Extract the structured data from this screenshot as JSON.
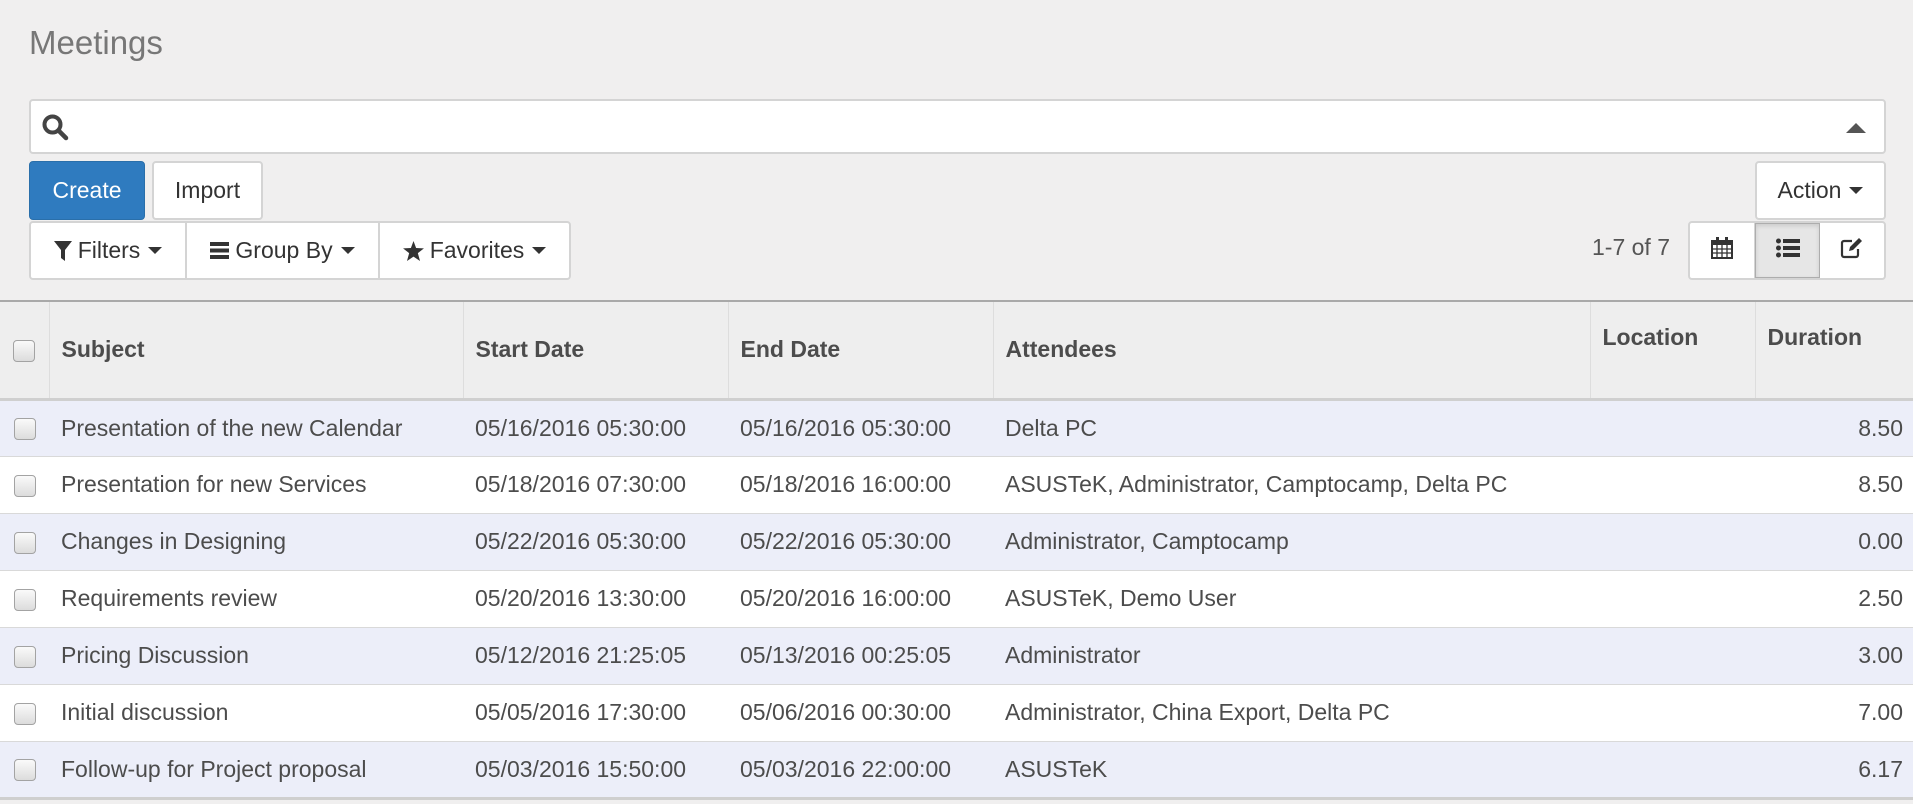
{
  "page": {
    "title": "Meetings"
  },
  "search": {
    "placeholder": "",
    "value": "",
    "icon": "search-icon",
    "toggle_icon": "caret-up-icon"
  },
  "toolbar": {
    "create_label": "Create",
    "import_label": "Import",
    "action_label": "Action"
  },
  "filters": {
    "filters_label": "Filters",
    "groupby_label": "Group By",
    "favorites_label": "Favorites"
  },
  "pager": {
    "text": "1-7 of 7"
  },
  "views": [
    {
      "name": "calendar",
      "icon": "calendar-icon",
      "active": false
    },
    {
      "name": "list",
      "icon": "list-icon",
      "active": true
    },
    {
      "name": "form",
      "icon": "edit-icon",
      "active": false
    }
  ],
  "table": {
    "columns": [
      "Subject",
      "Start Date",
      "End Date",
      "Attendees",
      "Location",
      "Duration"
    ],
    "rows": [
      {
        "subject": "Presentation of the new Calendar",
        "start": "05/16/2016 05:30:00",
        "end": "05/16/2016 05:30:00",
        "attendees": "Delta PC",
        "location": "",
        "duration": "8.50"
      },
      {
        "subject": "Presentation for new Services",
        "start": "05/18/2016 07:30:00",
        "end": "05/18/2016 16:00:00",
        "attendees": "ASUSTeK, Administrator, Camptocamp, Delta PC",
        "location": "",
        "duration": "8.50"
      },
      {
        "subject": "Changes in Designing",
        "start": "05/22/2016 05:30:00",
        "end": "05/22/2016 05:30:00",
        "attendees": "Administrator, Camptocamp",
        "location": "",
        "duration": "0.00"
      },
      {
        "subject": "Requirements review",
        "start": "05/20/2016 13:30:00",
        "end": "05/20/2016 16:00:00",
        "attendees": "ASUSTeK, Demo User",
        "location": "",
        "duration": "2.50"
      },
      {
        "subject": "Pricing Discussion",
        "start": "05/12/2016 21:25:05",
        "end": "05/13/2016 00:25:05",
        "attendees": "Administrator",
        "location": "",
        "duration": "3.00"
      },
      {
        "subject": "Initial discussion",
        "start": "05/05/2016 17:30:00",
        "end": "05/06/2016 00:30:00",
        "attendees": "Administrator, China Export, Delta PC",
        "location": "",
        "duration": "7.00"
      },
      {
        "subject": "Follow-up for Project proposal",
        "start": "05/03/2016 15:50:00",
        "end": "05/03/2016 22:00:00",
        "attendees": "ASUSTeK",
        "location": "",
        "duration": "6.17"
      }
    ]
  },
  "colors": {
    "primary": "#2f7bbf",
    "row_odd": "#eceef9",
    "row_even": "#ffffff",
    "background": "#f0efef"
  }
}
